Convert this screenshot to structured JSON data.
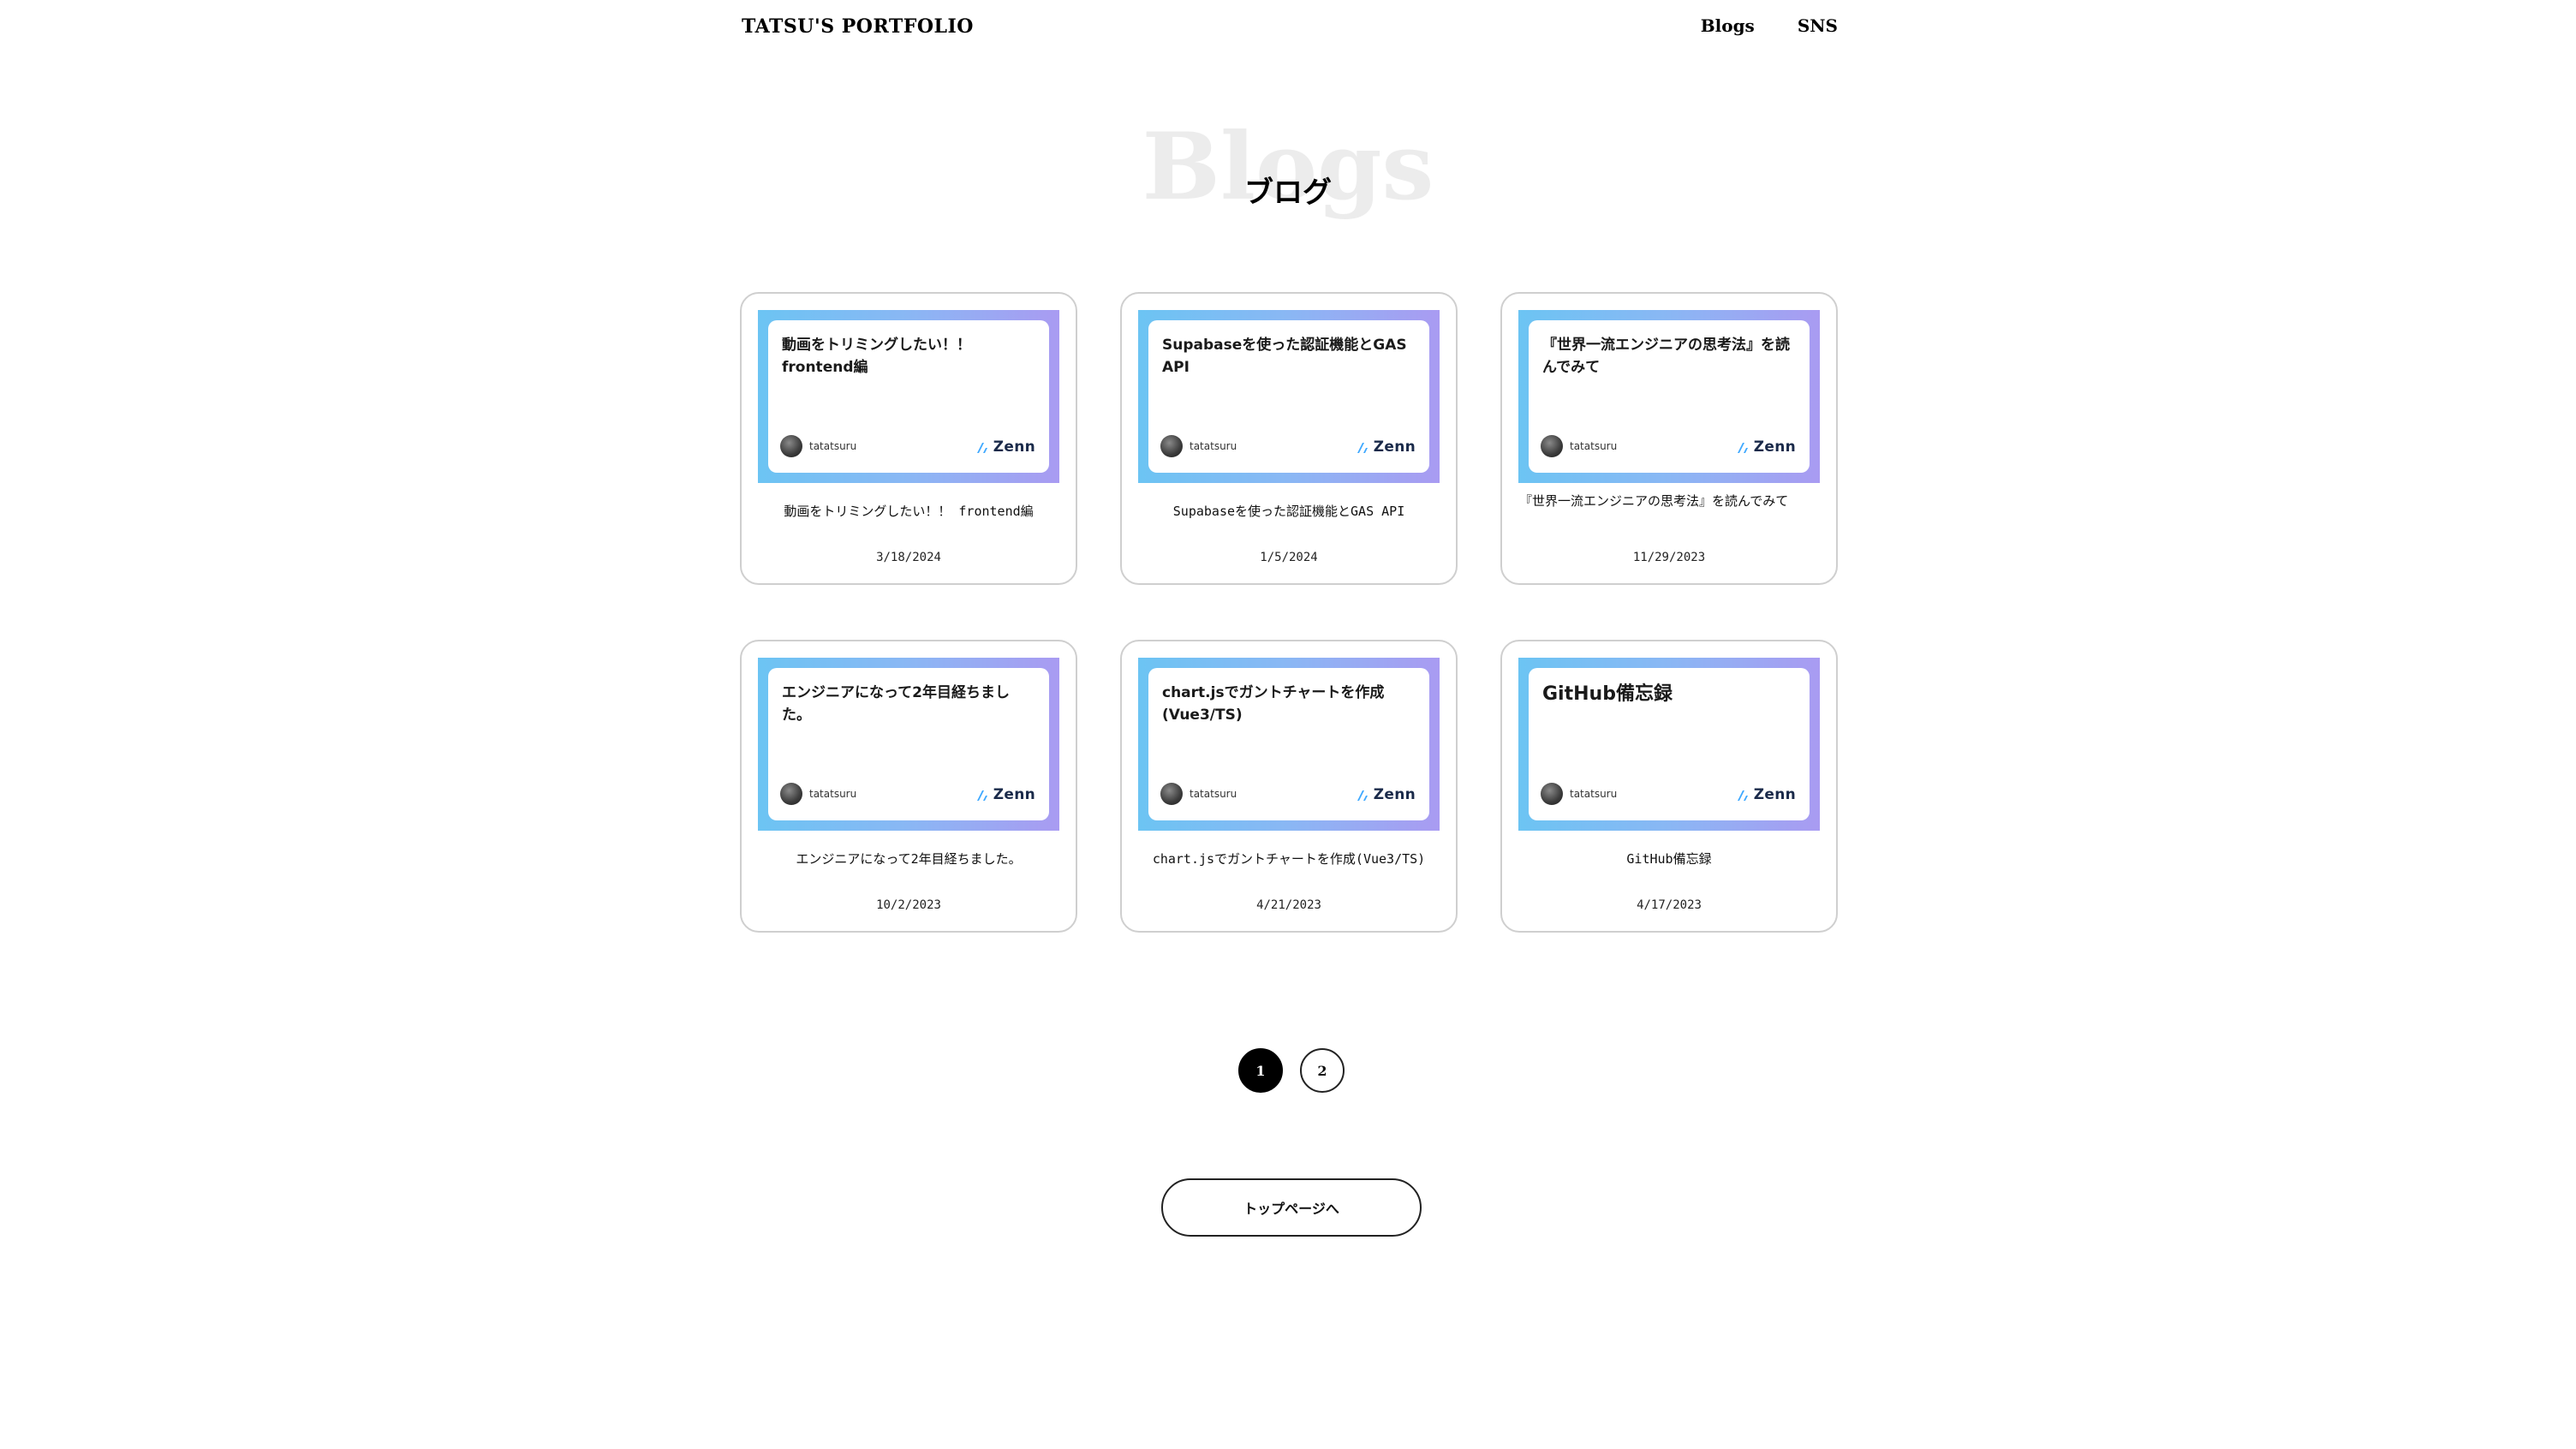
{
  "header": {
    "logo": "TATSU'S PORTFOLIO",
    "nav": [
      {
        "label": "Blogs"
      },
      {
        "label": "SNS"
      }
    ]
  },
  "title": {
    "background": "Blogs",
    "foreground": "ブログ"
  },
  "cards": [
    {
      "thumb_title": "動画をトリミングしたい！！frontend編",
      "author": "tatatsuru",
      "brand": "Zenn",
      "title": "動画をトリミングしたい！！ frontend編",
      "date": "3/18/2024"
    },
    {
      "thumb_title": "Supabaseを使った認証機能とGAS API",
      "author": "tatatsuru",
      "brand": "Zenn",
      "title": "Supabaseを使った認証機能とGAS API",
      "date": "1/5/2024"
    },
    {
      "thumb_title": "『世界一流エンジニアの思考法』を読んでみて",
      "author": "tatatsuru",
      "brand": "Zenn",
      "title": "『世界一流エンジニアの思考法』を読んでみて",
      "date": "11/29/2023"
    },
    {
      "thumb_title": "エンジニアになって2年目経ちました。",
      "author": "tatatsuru",
      "brand": "Zenn",
      "title": "エンジニアになって2年目経ちました。",
      "date": "10/2/2023"
    },
    {
      "thumb_title": "chart.jsでガントチャートを作成(Vue3/TS)",
      "author": "tatatsuru",
      "brand": "Zenn",
      "title": "chart.jsでガントチャートを作成(Vue3/TS)",
      "date": "4/21/2023"
    },
    {
      "thumb_title": "GitHub備忘録",
      "author": "tatatsuru",
      "brand": "Zenn",
      "title": "GitHub備忘録",
      "date": "4/17/2023"
    }
  ],
  "pagination": {
    "pages": [
      "1",
      "2"
    ],
    "current": "1"
  },
  "back_button": {
    "label": "トップページへ"
  },
  "colors": {
    "thumb_gradient_start": "#6cc4f3",
    "thumb_gradient_end": "#a99bf2",
    "zenn_blue": "#3ea8ff",
    "active_page": "#000000"
  }
}
